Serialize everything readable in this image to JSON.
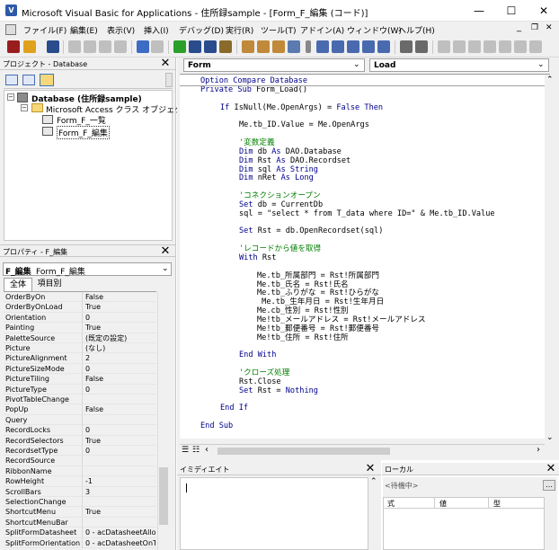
{
  "window": {
    "title": "Microsoft Visual Basic for Applications - 住所録sample - [Form_F_編集 (コード)]",
    "minimize": "—",
    "maximize": "☐",
    "close": "✕"
  },
  "menu": [
    "ファイル(F)",
    "編集(E)",
    "表示(V)",
    "挿入(I)",
    "デバッグ(D)",
    "実行(R)",
    "ツール(T)",
    "アドイン(A)",
    "ウィンドウ(W)",
    "ヘルプ(H)"
  ],
  "menu_right": {
    "minimize": "_",
    "restore": "❐",
    "close": "✕"
  },
  "project": {
    "header": "プロジェクト - Database",
    "root": "Database (住所録sample)",
    "folder": "Microsoft Access クラス オブジェクト",
    "items": [
      "Form_F_一覧",
      "Form_F_編集"
    ]
  },
  "properties": {
    "header": "プロパティ - F_編集",
    "object_name": "F_編集",
    "object_type": "Form_F_編集",
    "tabs": [
      "全体",
      "項目別"
    ],
    "rows": [
      {
        "name": "OrderByOn",
        "value": "False"
      },
      {
        "name": "OrderByOnLoad",
        "value": "True"
      },
      {
        "name": "Orientation",
        "value": "0"
      },
      {
        "name": "Painting",
        "value": "True"
      },
      {
        "name": "PaletteSource",
        "value": "(既定の設定)"
      },
      {
        "name": "Picture",
        "value": "(なし)"
      },
      {
        "name": "PictureAlignment",
        "value": "2"
      },
      {
        "name": "PictureSizeMode",
        "value": "0"
      },
      {
        "name": "PictureTiling",
        "value": "False"
      },
      {
        "name": "PictureType",
        "value": "0"
      },
      {
        "name": "PivotTableChange",
        "value": ""
      },
      {
        "name": "PopUp",
        "value": "False"
      },
      {
        "name": "Query",
        "value": ""
      },
      {
        "name": "RecordLocks",
        "value": "0"
      },
      {
        "name": "RecordSelectors",
        "value": "True"
      },
      {
        "name": "RecordsetType",
        "value": "0"
      },
      {
        "name": "RecordSource",
        "value": ""
      },
      {
        "name": "RibbonName",
        "value": ""
      },
      {
        "name": "RowHeight",
        "value": "-1"
      },
      {
        "name": "ScrollBars",
        "value": "3"
      },
      {
        "name": "SelectionChange",
        "value": ""
      },
      {
        "name": "ShortcutMenu",
        "value": "True"
      },
      {
        "name": "ShortcutMenuBar",
        "value": ""
      },
      {
        "name": "SplitFormDatasheet",
        "value": "0 - acDatasheetAllo"
      },
      {
        "name": "SplitFormOrientation",
        "value": "0 - acDatasheetOnT"
      }
    ]
  },
  "code_window": {
    "object_dropdown": "Form",
    "procedure_dropdown": "Load",
    "lines": [
      {
        "indent": 0,
        "parts": [
          {
            "t": "Option Compare Database",
            "c": "kw"
          }
        ]
      },
      {
        "indent": 0,
        "parts": [
          {
            "t": "Private Sub ",
            "c": "kw"
          },
          {
            "t": "Form_Load()",
            "c": ""
          }
        ]
      },
      {
        "indent": 0,
        "parts": []
      },
      {
        "indent": 1,
        "parts": [
          {
            "t": "If ",
            "c": "kw"
          },
          {
            "t": "IsNull(Me.OpenArgs) = ",
            "c": ""
          },
          {
            "t": "False Then",
            "c": "kw"
          }
        ]
      },
      {
        "indent": 0,
        "parts": []
      },
      {
        "indent": 2,
        "parts": [
          {
            "t": "Me.tb_ID.Value = Me.OpenArgs",
            "c": ""
          }
        ]
      },
      {
        "indent": 0,
        "parts": []
      },
      {
        "indent": 2,
        "parts": [
          {
            "t": "'変数定義",
            "c": "cm"
          }
        ]
      },
      {
        "indent": 2,
        "parts": [
          {
            "t": "Dim ",
            "c": "kw"
          },
          {
            "t": "db ",
            "c": ""
          },
          {
            "t": "As ",
            "c": "kw"
          },
          {
            "t": "DAO.Database",
            "c": ""
          }
        ]
      },
      {
        "indent": 2,
        "parts": [
          {
            "t": "Dim ",
            "c": "kw"
          },
          {
            "t": "Rst ",
            "c": ""
          },
          {
            "t": "As ",
            "c": "kw"
          },
          {
            "t": "DAO.Recordset",
            "c": ""
          }
        ]
      },
      {
        "indent": 2,
        "parts": [
          {
            "t": "Dim ",
            "c": "kw"
          },
          {
            "t": "sql ",
            "c": ""
          },
          {
            "t": "As String",
            "c": "kw"
          }
        ]
      },
      {
        "indent": 2,
        "parts": [
          {
            "t": "Dim ",
            "c": "kw"
          },
          {
            "t": "nRet ",
            "c": ""
          },
          {
            "t": "As Long",
            "c": "kw"
          }
        ]
      },
      {
        "indent": 0,
        "parts": []
      },
      {
        "indent": 2,
        "parts": [
          {
            "t": "'コネクションオープン",
            "c": "cm"
          }
        ]
      },
      {
        "indent": 2,
        "parts": [
          {
            "t": "Set ",
            "c": "kw"
          },
          {
            "t": "db = CurrentDb",
            "c": ""
          }
        ]
      },
      {
        "indent": 2,
        "parts": [
          {
            "t": "sql = \"select * from T_data where ID=\" & Me.tb_ID.Value",
            "c": ""
          }
        ]
      },
      {
        "indent": 0,
        "parts": []
      },
      {
        "indent": 2,
        "parts": [
          {
            "t": "Set ",
            "c": "kw"
          },
          {
            "t": "Rst = db.OpenRecordset(sql)",
            "c": ""
          }
        ]
      },
      {
        "indent": 0,
        "parts": []
      },
      {
        "indent": 2,
        "parts": [
          {
            "t": "'レコードから値を取得",
            "c": "cm"
          }
        ]
      },
      {
        "indent": 2,
        "parts": [
          {
            "t": "With ",
            "c": "kw"
          },
          {
            "t": "Rst",
            "c": ""
          }
        ]
      },
      {
        "indent": 0,
        "parts": []
      },
      {
        "indent": 3,
        "parts": [
          {
            "t": "Me.tb_所属部門 = Rst!所属部門",
            "c": ""
          }
        ]
      },
      {
        "indent": 3,
        "parts": [
          {
            "t": "Me.tb_氏名 = Rst!氏名",
            "c": ""
          }
        ]
      },
      {
        "indent": 3,
        "parts": [
          {
            "t": "Me.tb_ふりがな = Rst!ひらがな",
            "c": ""
          }
        ]
      },
      {
        "indent": 3,
        "parts": [
          {
            "t": " Me.tb_生年月日 = Rst!生年月日",
            "c": ""
          }
        ]
      },
      {
        "indent": 3,
        "parts": [
          {
            "t": "Me.cb_性別 = Rst!性別",
            "c": ""
          }
        ]
      },
      {
        "indent": 3,
        "parts": [
          {
            "t": "Me!tb_メールアドレス = Rst!メールアドレス",
            "c": ""
          }
        ]
      },
      {
        "indent": 3,
        "parts": [
          {
            "t": "Me!tb_郵便番号 = Rst!郵便番号",
            "c": ""
          }
        ]
      },
      {
        "indent": 3,
        "parts": [
          {
            "t": "Me!tb_住所 = Rst!住所",
            "c": ""
          }
        ]
      },
      {
        "indent": 0,
        "parts": []
      },
      {
        "indent": 2,
        "parts": [
          {
            "t": "End With",
            "c": "kw"
          }
        ]
      },
      {
        "indent": 0,
        "parts": []
      },
      {
        "indent": 2,
        "parts": [
          {
            "t": "'クローズ処理",
            "c": "cm"
          }
        ]
      },
      {
        "indent": 2,
        "parts": [
          {
            "t": "Rst.Close",
            "c": ""
          }
        ]
      },
      {
        "indent": 2,
        "parts": [
          {
            "t": "Set ",
            "c": "kw"
          },
          {
            "t": "Rst = ",
            "c": ""
          },
          {
            "t": "Nothing",
            "c": "kw"
          }
        ]
      },
      {
        "indent": 0,
        "parts": []
      },
      {
        "indent": 1,
        "parts": [
          {
            "t": "End If",
            "c": "kw"
          }
        ]
      },
      {
        "indent": 0,
        "parts": []
      },
      {
        "indent": 0,
        "parts": [
          {
            "t": "End Sub",
            "c": "kw"
          }
        ]
      }
    ]
  },
  "immediate": {
    "header": "イミディエイト"
  },
  "locals": {
    "header": "ローカル",
    "status": "<待機中>",
    "columns": [
      "式",
      "値",
      "型"
    ]
  },
  "colors": {
    "keyword": "#00008b",
    "comment": "#008000",
    "chrome": "#f0f0f0",
    "pane_header": "#dcdcdc"
  }
}
